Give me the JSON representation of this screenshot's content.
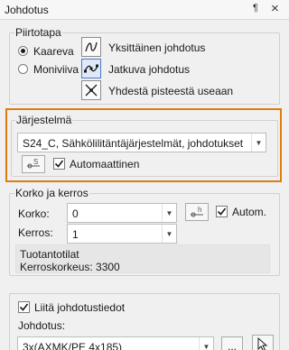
{
  "window": {
    "title": "Johdotus",
    "pin_glyph": "¶",
    "close_glyph": "×"
  },
  "piirtotapa": {
    "legend": "Piirtotapa",
    "options": [
      {
        "label": "Kaareva",
        "selected": true
      },
      {
        "label": "Moniviiva",
        "selected": false
      }
    ],
    "modes": [
      {
        "label": "Yksittäinen johdotus",
        "selected": false
      },
      {
        "label": "Jatkuva johdotus",
        "selected": true
      },
      {
        "label": "Yhdestä pisteestä useaan",
        "selected": false
      }
    ]
  },
  "jarjestelma": {
    "legend": "Järjestelmä",
    "value": "S24_C, Sähkölilitäntäjärjestelmät, johdotukset",
    "automaattinen_label": "Automaattinen",
    "automaattinen_checked": true
  },
  "korko_ja_kerros": {
    "legend": "Korko ja kerros",
    "korko_label": "Korko:",
    "korko_value": "0",
    "kerros_label": "Kerros:",
    "kerros_value": "1",
    "autom_label": "Autom.",
    "autom_checked": true,
    "info_line1": "Tuotantotilat",
    "info_line2": "Kerroskorkeus: 3300"
  },
  "johdotustiedot": {
    "liita_label": "Liitä johdotustiedot",
    "liita_checked": true,
    "johdotus_label": "Johdotus:",
    "johdotus_value": "3x(AXMK/PE 4x185)",
    "ellipsis_label": "..."
  },
  "colors": {
    "highlight_border": "#e07b10",
    "selected_button": "#dfe9f8"
  }
}
